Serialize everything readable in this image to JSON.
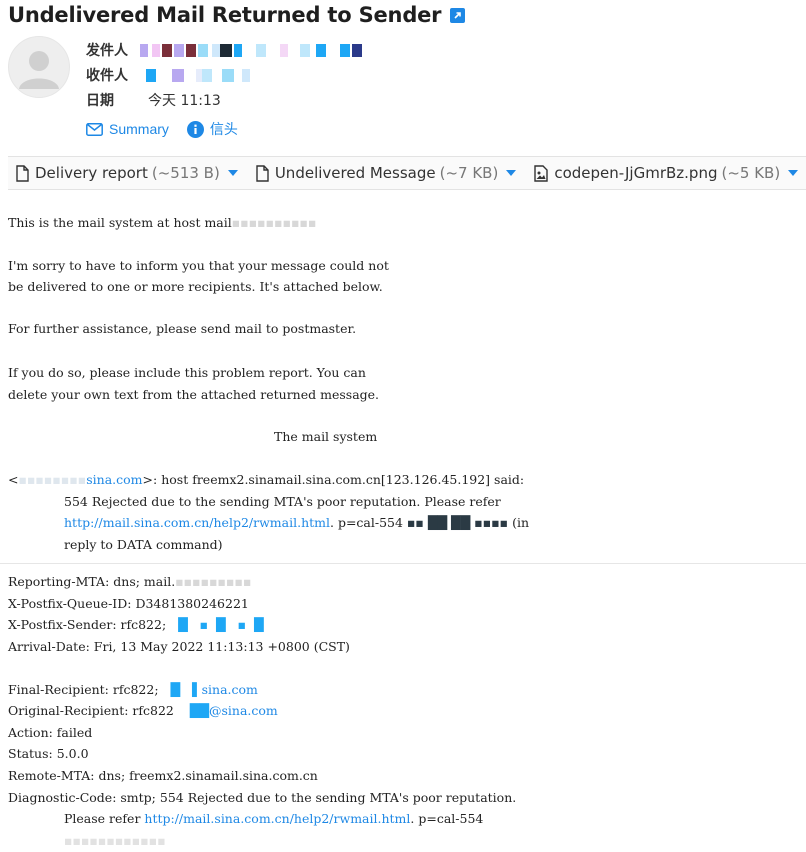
{
  "email": {
    "subject": "Undelivered Mail Returned to Sender",
    "from_label": "发件人",
    "to_label": "收件人",
    "date_label": "日期",
    "date_value": "今天 11:13",
    "summary_link": "Summary",
    "headers_link": "信头"
  },
  "attachments": [
    {
      "name": "Delivery report",
      "size": "(~513 B)"
    },
    {
      "name": "Undelivered Message",
      "size": "(~7 KB)"
    },
    {
      "name": "codepen-JjGmrBz.png",
      "size": "(~5 KB)"
    }
  ],
  "body": {
    "l1": "This is the mail system at host mail",
    "l2": "I'm sorry to have to inform you that your message could not",
    "l3": "be delivered to one or more recipients. It's attached below.",
    "l4": "For further assistance, please send mail to postmaster.",
    "l5": "If you do so, please include this problem report. You can",
    "l6": "delete your own text from the attached returned message.",
    "l7": "The mail system",
    "l8_a": "<",
    "l8_b": "sina.com",
    "l8_c": ">: host freemx2.sinamail.sina.com.cn[123.126.45.192] said:",
    "l9": "554 Rejected due to the sending MTA's poor reputation. Please refer",
    "l10_link": "http://mail.sina.com.cn/help2/rwmail.html",
    "l10_b": ". p=cal-554",
    "l10_c": "(in",
    "l11": "reply to DATA command)"
  },
  "report": {
    "r1": "Reporting-MTA: dns; mail.",
    "r2": "X-Postfix-Queue-ID: D3481380246221",
    "r3": "X-Postfix-Sender: rfc822;",
    "r4": "Arrival-Date: Fri, 13 May 2022 11:13:13 +0800 (CST)",
    "r5_a": "Final-Recipient: rfc822;",
    "r5_b": "sina.com",
    "r6_a": "Original-Recipient: rfc822",
    "r6_b": "@sina.com",
    "r7": "Action: failed",
    "r8": "Status: 5.0.0",
    "r9": "Remote-MTA: dns; freemx2.sinamail.sina.com.cn",
    "r10": "Diagnostic-Code: smtp; 554 Rejected due to the sending MTA's poor reputation.",
    "r11_a": "Please refer ",
    "r11_link": "http://mail.sina.com.cn/help2/rwmail.html",
    "r11_b": ". p=cal-554"
  },
  "colors": {
    "accent": "#1e88e5",
    "redact_blue": "#1ea7f5",
    "redact_dark": "#333a44"
  }
}
